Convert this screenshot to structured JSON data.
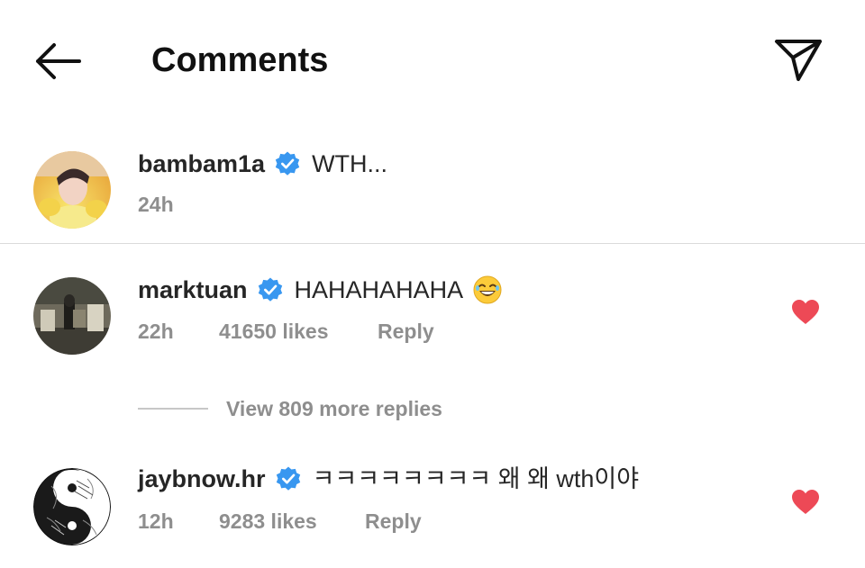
{
  "header": {
    "title": "Comments",
    "back_icon": "arrow-left-icon",
    "share_icon": "paper-plane-icon"
  },
  "caption": {
    "username": "bambam1a",
    "verified": true,
    "text": "WTH...",
    "time": "24h"
  },
  "comments": [
    {
      "username": "marktuan",
      "verified": true,
      "text": "HAHAHAHAHA",
      "emoji": "😂",
      "time": "22h",
      "likes": "41650 likes",
      "reply_label": "Reply",
      "liked": true
    },
    {
      "username": "jaybnow.hr",
      "verified": true,
      "text": "ㅋㅋㅋㅋㅋㅋㅋㅋ 왜 왜 wth이야",
      "time": "12h",
      "likes": "9283 likes",
      "reply_label": "Reply",
      "liked": true
    }
  ],
  "view_replies": {
    "label": "View 809 more replies"
  },
  "colors": {
    "verified_blue": "#3897f0",
    "heart_red": "#ed4956",
    "meta_gray": "#8e8e8e",
    "divider": "#dbdbdb"
  }
}
